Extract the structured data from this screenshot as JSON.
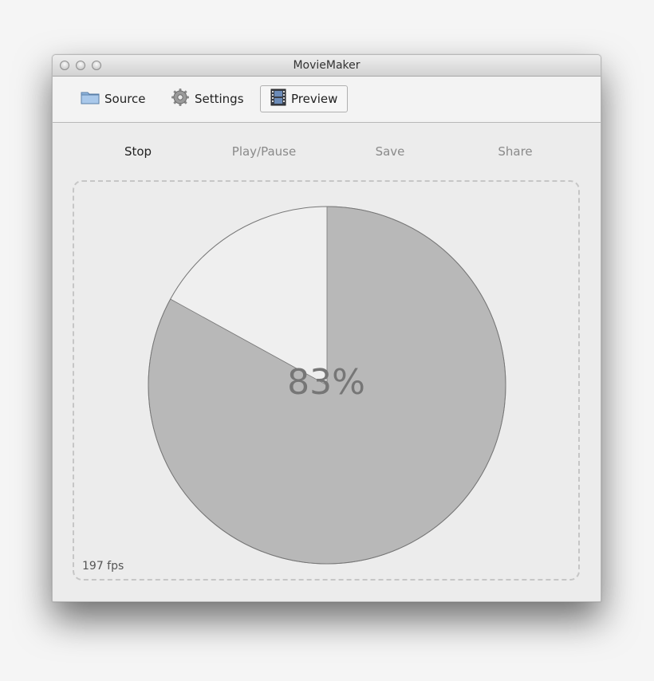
{
  "window": {
    "title": "MovieMaker"
  },
  "toolbar": {
    "source": {
      "label": "Source",
      "icon": "folder-icon"
    },
    "settings": {
      "label": "Settings",
      "icon": "gear-icon"
    },
    "preview": {
      "label": "Preview",
      "icon": "film-icon"
    }
  },
  "tabs": [
    {
      "label": "Stop",
      "active": true
    },
    {
      "label": "Play/Pause",
      "active": false
    },
    {
      "label": "Save",
      "active": false
    },
    {
      "label": "Share",
      "active": false
    }
  ],
  "preview": {
    "progress_text": "83%",
    "progress_fraction": 0.83,
    "fps_text": "197 fps"
  },
  "colors": {
    "pie_fill": "#b8b8b8",
    "pie_empty": "#efefef",
    "pie_stroke": "#777777",
    "active_tab": "#222222",
    "inactive_tab": "#8a8a8a"
  }
}
